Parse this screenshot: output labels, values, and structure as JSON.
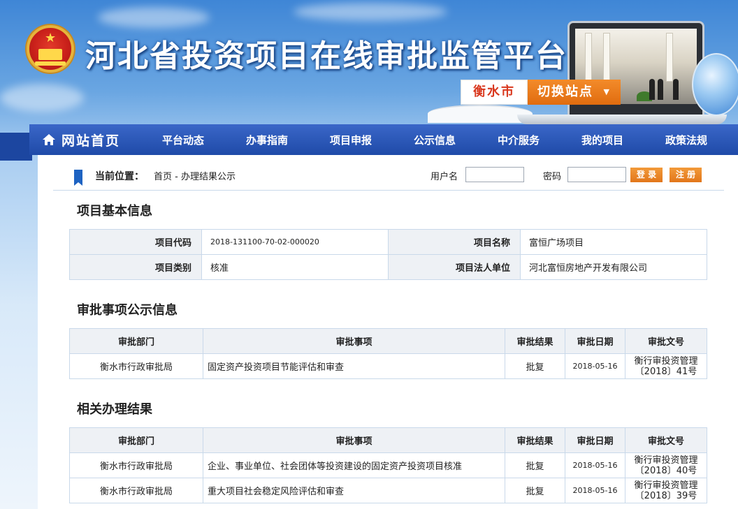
{
  "header": {
    "title": "河北省投资项目在线审批监管平台",
    "city": "衡水市",
    "switch_label": "切换站点",
    "switch_caret": "▼"
  },
  "nav": {
    "home": "网站首页",
    "items": [
      "平台动态",
      "办事指南",
      "项目申报",
      "公示信息",
      "中介服务",
      "我的项目",
      "政策法规"
    ]
  },
  "breadcrumb": {
    "label": "当前位置：",
    "path": "首页 - 办理结果公示"
  },
  "login": {
    "username_label": "用户名",
    "password_label": "密码",
    "username_value": "",
    "password_value": "",
    "login_button": "登 录",
    "register_button": "注 册"
  },
  "basic_info": {
    "title": "项目基本信息",
    "code_label": "项目代码",
    "code_value": "2018-131100-70-02-000020",
    "name_label": "项目名称",
    "name_value": "富恒广场项目",
    "type_label": "项目类别",
    "type_value": "核准",
    "legal_label": "项目法人单位",
    "legal_value": "河北富恒房地产开发有限公司"
  },
  "approval_info": {
    "title": "审批事项公示信息",
    "headers": [
      "审批部门",
      "审批事项",
      "审批结果",
      "审批日期",
      "审批文号"
    ],
    "rows": [
      {
        "dept": "衡水市行政审批局",
        "item": "固定资产投资项目节能评估和审查",
        "result": "批复",
        "date": "2018-05-16",
        "doc_1": "衡行审投资管理",
        "doc_2": "〔2018〕41号"
      }
    ]
  },
  "related_results": {
    "title": "相关办理结果",
    "headers": [
      "审批部门",
      "审批事项",
      "审批结果",
      "审批日期",
      "审批文号"
    ],
    "rows": [
      {
        "dept": "衡水市行政审批局",
        "item": "企业、事业单位、社会团体等投资建设的固定资产投资项目核准",
        "result": "批复",
        "date": "2018-05-16",
        "doc_1": "衡行审投资管理",
        "doc_2": "〔2018〕40号"
      },
      {
        "dept": "衡水市行政审批局",
        "item": "重大项目社会稳定风险评估和审查",
        "result": "批复",
        "date": "2018-05-16",
        "doc_1": "衡行审投资管理",
        "doc_2": "〔2018〕39号"
      }
    ]
  }
}
